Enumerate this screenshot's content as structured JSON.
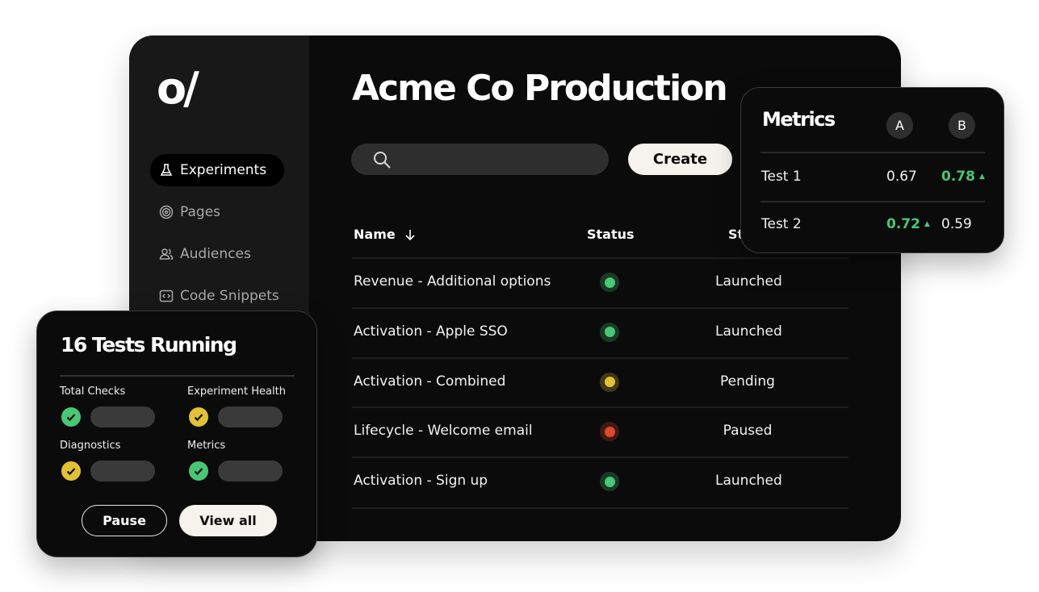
{
  "logo": "o/",
  "sidebar": {
    "items": [
      {
        "label": "Experiments",
        "icon": "flask-icon",
        "active": true
      },
      {
        "label": "Pages",
        "icon": "radar-icon",
        "active": false
      },
      {
        "label": "Audiences",
        "icon": "users-icon",
        "active": false
      },
      {
        "label": "Code Snippets",
        "icon": "code-icon",
        "active": false
      }
    ]
  },
  "header": {
    "title": "Acme Co Production"
  },
  "search": {
    "placeholder": "",
    "icon": "search-icon"
  },
  "toolbar": {
    "create_label": "Create"
  },
  "table": {
    "columns": [
      "Name",
      "Status",
      "St"
    ],
    "sort_icon": "arrow-down-icon",
    "rows": [
      {
        "name": "Revenue - Additional options",
        "status_color": "#48c774",
        "state": "Launched"
      },
      {
        "name": "Activation - Apple SSO",
        "status_color": "#48c774",
        "state": "Launched"
      },
      {
        "name": "Activation - Combined",
        "status_color": "#e2c234",
        "state": "Pending"
      },
      {
        "name": "Lifecycle - Welcome email",
        "status_color": "#e0482f",
        "state": "Paused"
      },
      {
        "name": "Activation - Sign up",
        "status_color": "#48c774",
        "state": "Launched"
      }
    ]
  },
  "metrics": {
    "title": "Metrics",
    "col_a": "A",
    "col_b": "B",
    "rows": [
      {
        "label": "Test 1",
        "a": "0.67",
        "b": "0.78",
        "winner": "b"
      },
      {
        "label": "Test 2",
        "a": "0.72",
        "b": "0.59",
        "winner": "a"
      }
    ]
  },
  "tests": {
    "title": "16 Tests Running",
    "checks": [
      {
        "label": "Total Checks",
        "color": "#48c774"
      },
      {
        "label": "Experiment Health",
        "color": "#e2c234"
      },
      {
        "label": "Diagnostics",
        "color": "#e2c234"
      },
      {
        "label": "Metrics",
        "color": "#48c774"
      }
    ],
    "pause_label": "Pause",
    "view_all_label": "View all"
  },
  "colors": {
    "accent_green": "#48c774",
    "warn_yellow": "#e2c234",
    "error_red": "#e0482f",
    "cream": "#f6f3ec"
  }
}
